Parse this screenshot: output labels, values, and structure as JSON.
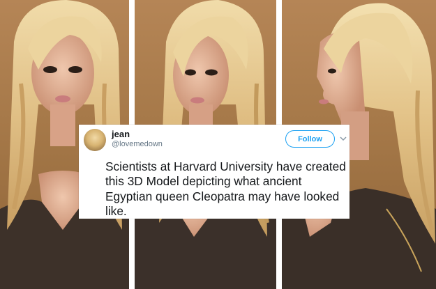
{
  "tweet": {
    "display_name": "jean",
    "handle": "@lovemedown",
    "follow_label": "Follow",
    "text": "Scientists at Harvard University have created this 3D Model depicting what ancient Egyptian queen Cleopatra may have looked like."
  },
  "icons": {
    "avatar": "avatar-image",
    "chevron": "chevron-down-icon"
  },
  "colors": {
    "background_brown": "#a57848",
    "hair_blonde": "#e3c489",
    "skin": "#e3b59a",
    "outfit_dark": "#3d3129",
    "follow_blue": "#1da1f2",
    "text_dark": "#14171a",
    "handle_gray": "#657786"
  }
}
